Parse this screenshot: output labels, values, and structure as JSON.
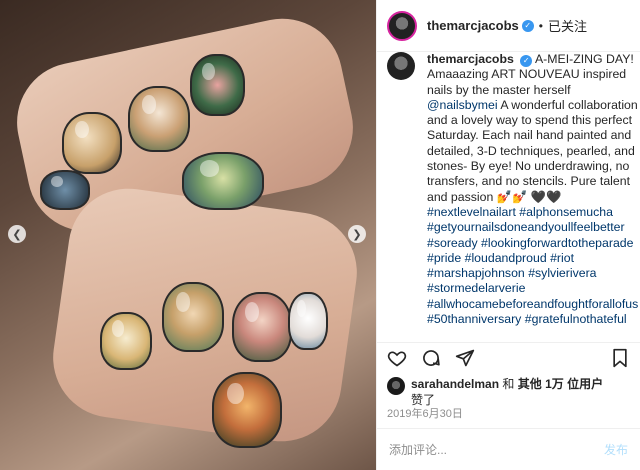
{
  "post": {
    "image_alt": "Hand with art nouveau painted nails",
    "prev_icon": "chevron-left-icon",
    "next_icon": "chevron-right-icon"
  },
  "header": {
    "username": "themarcjacobs",
    "verified_glyph": "✓",
    "separator": "•",
    "follow_label": "已关注"
  },
  "caption": {
    "username": "themarcjacobs",
    "text_before_mention": "A-MEI-ZING DAY! Amaaazing ART NOUVEAU inspired nails by the master herself",
    "mention": "@nailsbymei",
    "text_after_mention": "A wonderful collaboration and a lovely way to spend this perfect Saturday. Each nail hand painted and detailed, 3-D techniques, pearled, and stones- By eye! No underdrawing, no transfers, and no stencils. Pure talent and passion 💅💅 🖤🖤",
    "hashtags": [
      "#nextlevelnailart",
      "#alphonsemucha",
      "#getyournailsdoneandyoullfeelbetter",
      "#soready",
      "#lookingforwardtotheparade",
      "#pride",
      "#loudandproud",
      "#riot",
      "#marshapjohnson",
      "#sylvierivera",
      "#stormedelarverie",
      "#allwhocamebeforeandfoughtforallofus",
      "#50thanniversary",
      "#gratefulnothateful"
    ]
  },
  "actions": {
    "like_icon": "heart-icon",
    "comment_icon": "comment-icon",
    "share_icon": "share-icon",
    "save_icon": "bookmark-icon"
  },
  "likes": {
    "user": "sarahandelman",
    "connector": "和",
    "others": "其他 1万 位用户",
    "suffix": "赞了"
  },
  "date": "2019年6月30日",
  "comment": {
    "placeholder": "添加评论...",
    "post_label": "发布"
  },
  "colors": {
    "link": "#00376b",
    "verified": "#3897f0",
    "post_disabled": "#b2dffc",
    "muted": "#8e8e8e"
  }
}
